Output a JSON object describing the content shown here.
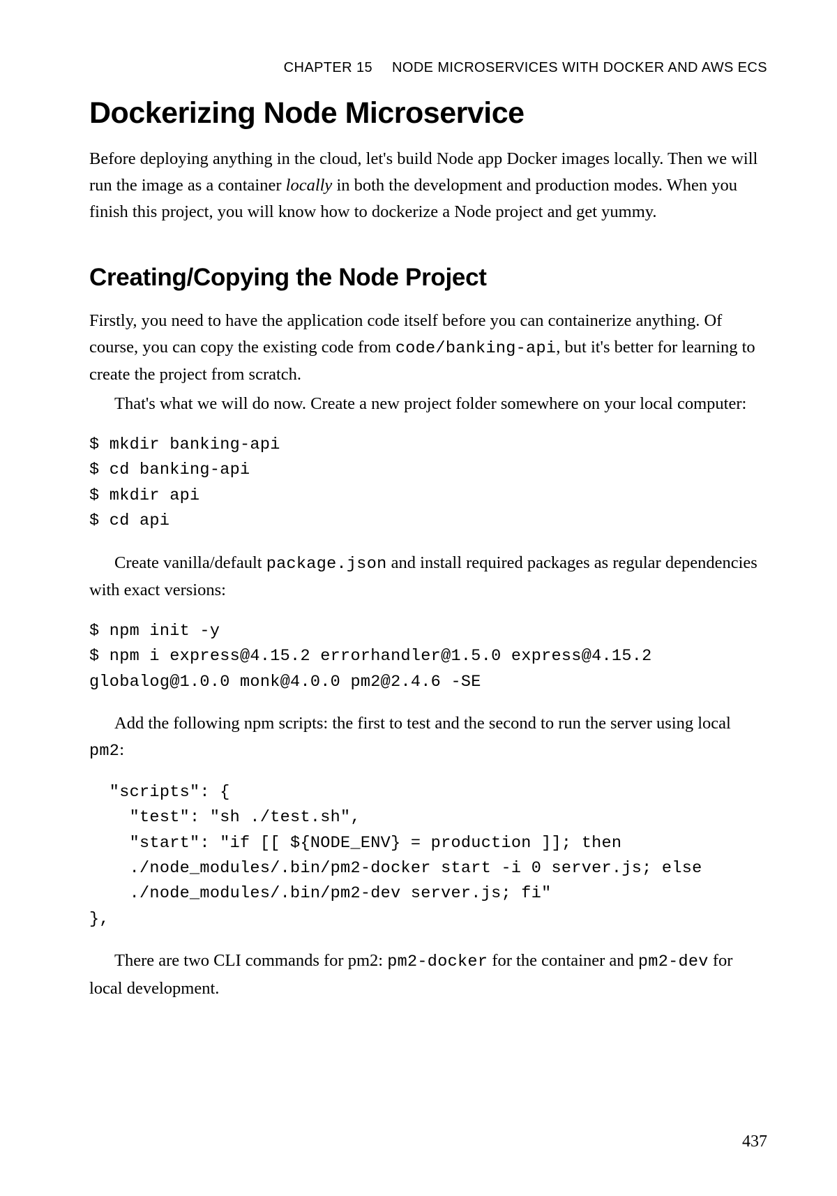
{
  "running_head": {
    "chapter_label": "CHAPTER 15",
    "chapter_title": "NODE MICROSERVICES WITH DOCKER AND AWS ECS"
  },
  "h1": "Dockerizing Node Microservice",
  "p1_a": "Before deploying anything in the cloud, let's build Node app Docker images locally. Then we will run the image as a container ",
  "p1_italic": "locally",
  "p1_b": " in both the development and production modes. When you finish this project, you will know how to dockerize a Node project and get yummy.",
  "h2": "Creating/Copying the Node Project",
  "p2_a": "Firstly, you need to have the application code itself before you can containerize anything. Of course, you can copy the existing code from ",
  "p2_code": "code/banking-api",
  "p2_b": ", but it's better for learning to create the project from scratch.",
  "p3": "That's what we will do now. Create a new project folder somewhere on your local computer:",
  "code1": "$ mkdir banking-api\n$ cd banking-api\n$ mkdir api\n$ cd api",
  "p4_a": "Create vanilla/default ",
  "p4_code": "package.json",
  "p4_b": " and install required packages as regular dependencies with exact versions:",
  "code2": "$ npm init -y\n$ npm i express@4.15.2 errorhandler@1.5.0 express@4.15.2 \nglobalog@1.0.0 monk@4.0.0 pm2@2.4.6 -SE",
  "p5_a": "Add the following npm scripts: the first to test and the second to run the server using local ",
  "p5_code": "pm2",
  "p5_b": ":",
  "code3_l1_a": "  \"scripts\": {",
  "code3_l2_a": "    \"test\": \"sh ./test.sh\",",
  "code3_l3_a": "    \"start\": \"if [[ ${NODE_ENV} = production ]]; then ",
  "code3_l4_a": "    ./node_modules/.bin/pm2-docker start -i 0 server.js; else ",
  "code3_l5_a": "    ./node_modules/.bin/pm2-dev server.js; fi\"",
  "code3_l6_a": "},",
  "p6_a": "There are two CLI commands for pm2: ",
  "p6_code1": "pm2-docker",
  "p6_b": " for the container and ",
  "p6_code2": "pm2-dev",
  "p6_c": " for local development.",
  "page_number": "437"
}
